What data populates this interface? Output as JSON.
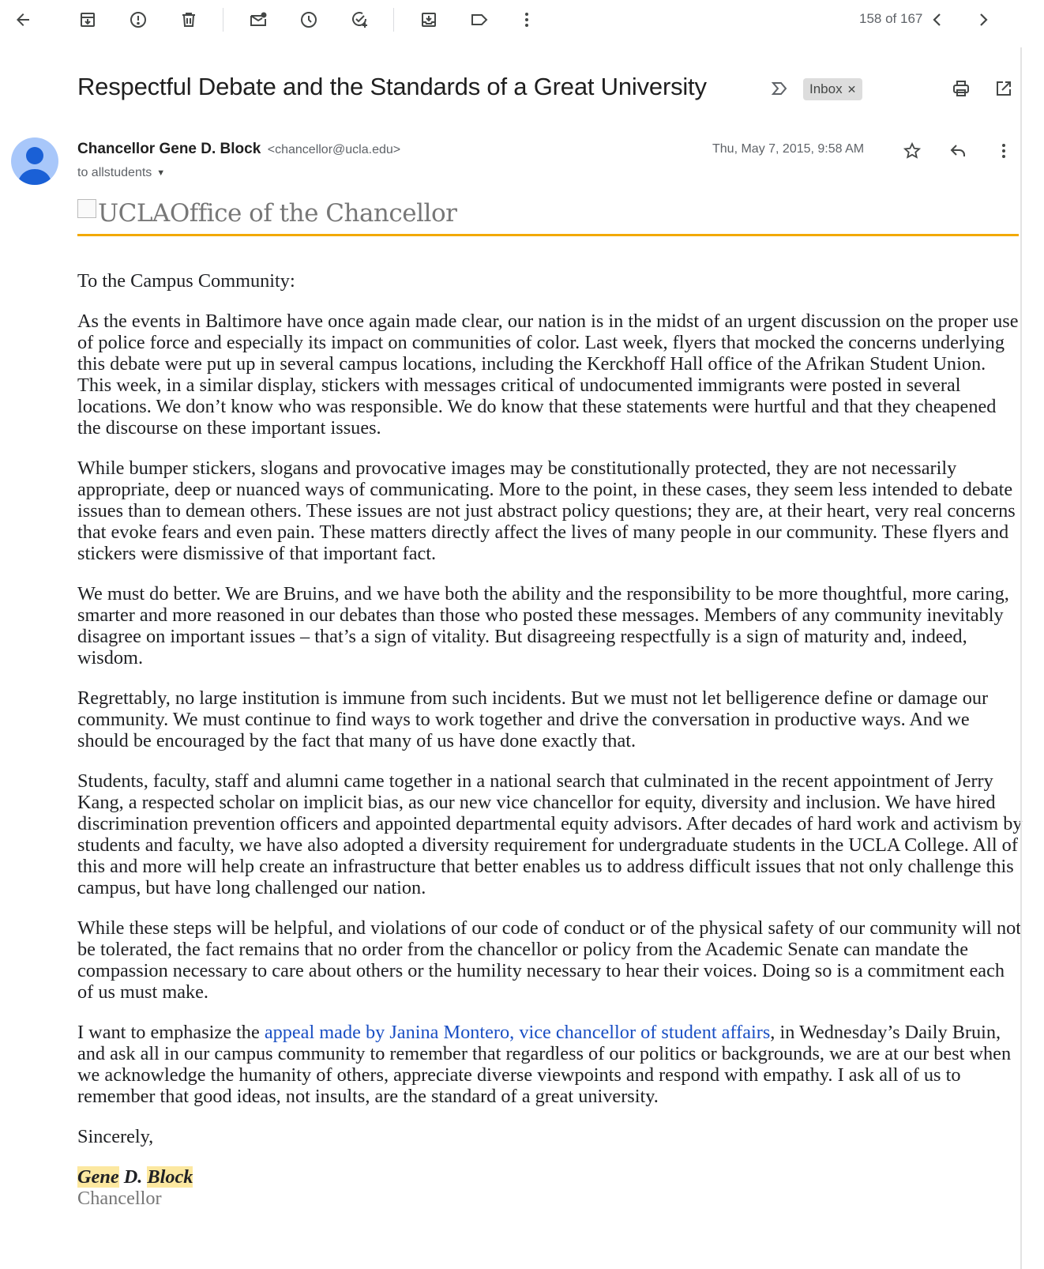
{
  "toolbar": {
    "icons": [
      "back-arrow-icon",
      "archive-icon",
      "report-spam-icon",
      "delete-icon",
      "mark-unread-icon",
      "snooze-icon",
      "add-task-icon",
      "move-to-icon",
      "label-icon",
      "more-vert-icon"
    ],
    "counter": "158 of 167"
  },
  "email": {
    "subject": "Respectful Debate and the Standards of a Great University",
    "label": "Inbox",
    "sender_name": "Chancellor Gene D. Block",
    "sender_email": "<chancellor@ucla.edu>",
    "recipient": "to allstudents",
    "date": "Thu, May 7, 2015, 9:58 AM",
    "banner_alt": "UCLAOffice of the Chancellor",
    "body": {
      "greeting": "To the Campus Community:",
      "p1": "As the events in Baltimore have once again made clear, our nation is in the midst of an urgent discussion on the proper use of police force and especially its impact on communities of color. Last week, flyers that mocked the concerns underlying this debate were put up in several campus locations, including the Kerckhoff Hall office of the Afrikan Student Union. This week, in a similar display, stickers with messages critical of undocumented immigrants were posted in several locations. We don’t know who was responsible. We do know that these statements were hurtful and that they cheapened the discourse on these important issues.",
      "p2": "While bumper stickers, slogans and provocative images may be constitutionally protected, they are not necessarily appropriate, deep or nuanced ways of communicating. More to the point, in these cases, they seem less intended to debate issues than to demean others. These issues are not just abstract policy questions; they are, at their heart, very real concerns that evoke fears and even pain. These matters directly affect the lives of many people in our community. These flyers and stickers were dismissive of that important fact.",
      "p3": "We must do better. We are Bruins, and we have both the ability and the responsibility to be more thoughtful, more caring, smarter and more reasoned in our debates than those who posted these messages. Members of any community inevitably disagree on important issues – that’s a sign of vitality. But disagreeing respectfully is a sign of maturity and, indeed, wisdom.",
      "p4": "Regrettably, no large institution is immune from such incidents. But we must not let belligerence define or damage our community. We must continue to find ways to work together and drive the conversation in productive ways. And we should be encouraged by the fact that many of us have done exactly that.",
      "p5": "Students, faculty, staff and alumni came together in a national search that culminated in the recent appointment of Jerry Kang, a respected scholar on implicit bias, as our new vice chancellor for equity, diversity and inclusion. We have hired discrimination prevention officers and appointed departmental equity advisors. After decades of hard work and activism by students and faculty, we have also adopted a diversity requirement for undergraduate students in the UCLA College. All of this and more will help create an infrastructure that better enables us to address difficult issues that not only challenge this campus, but have long challenged our nation.",
      "p6": "While these steps will be helpful, and violations of our code of conduct or of the physical safety of our community will not be tolerated, the fact remains that no order from the chancellor or policy from the Academic Senate can mandate the compassion necessary to care about others or the humility necessary to hear their voices. Doing so is a commitment each of us must make.",
      "p7_pre": "I want to emphasize the ",
      "p7_link": "appeal made by Janina Montero, vice chancellor of student affairs",
      "p7_post": ", in Wednesday’s Daily Bruin, and ask all in our campus community to remember that regardless of our politics or backgrounds, we are at our best when we acknowledge the humanity of others, appreciate diverse viewpoints and respond with empathy. I ask all of us to remember that good ideas, not insults, are the standard of a great university.",
      "closing": "Sincerely,",
      "sig_first": "Gene",
      "sig_middle": " D. ",
      "sig_last": "Block",
      "sig_title": "Chancellor"
    }
  },
  "colors": {
    "banner_rule": "#f2a900",
    "link": "#1a4fc4",
    "highlight": "#fce8a0",
    "avatar": "#a8c7fa"
  }
}
